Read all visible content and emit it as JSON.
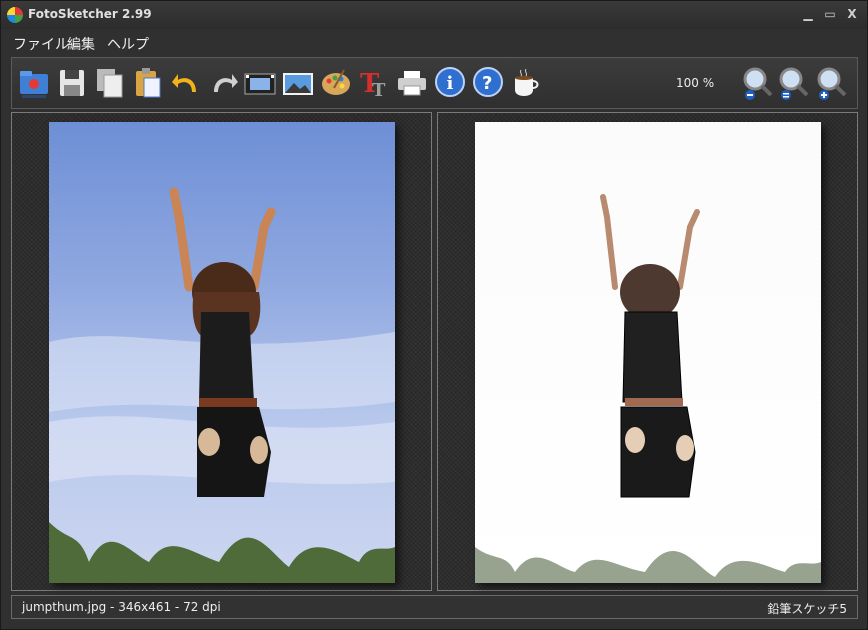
{
  "window": {
    "title": "FotoSketcher 2.99",
    "minimize": "▁",
    "maximize": "▭",
    "close": "X"
  },
  "menu": {
    "items": [
      "ファイル",
      "編集",
      "ヘルプ"
    ]
  },
  "toolbar": {
    "tools": [
      "open-icon",
      "save-icon",
      "copy-icon",
      "paste-icon",
      "undo-icon",
      "redo-icon",
      "filmstrip-icon",
      "image-icon",
      "palette-icon",
      "text-icon",
      "print-icon",
      "info-icon",
      "help-icon",
      "coffee-icon"
    ],
    "zoom_label": "100 %",
    "zoom_tools": [
      "zoom-out-icon",
      "zoom-actual-icon",
      "zoom-in-icon"
    ]
  },
  "status": {
    "file_info": "jumpthum.jpg - 346x461 - 72 dpi",
    "effect": "鉛筆スケッチ5"
  }
}
